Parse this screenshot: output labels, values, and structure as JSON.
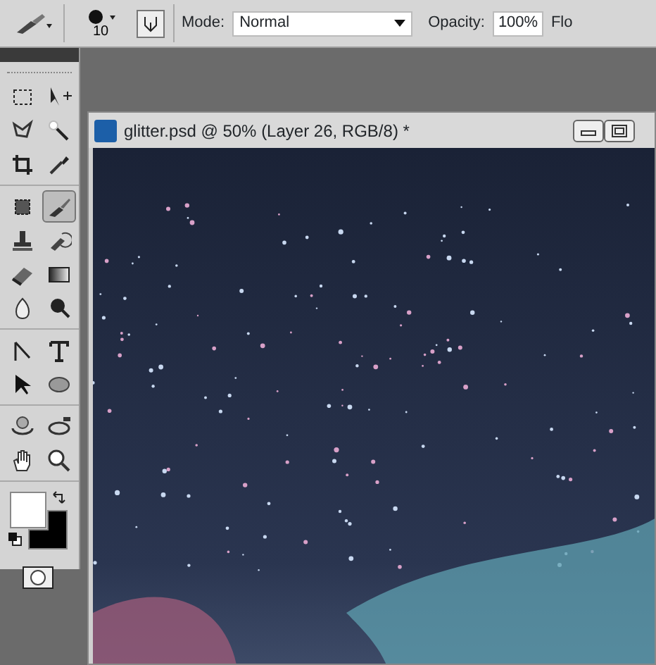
{
  "options_bar": {
    "brush_size": "10",
    "mode_label": "Mode:",
    "mode_value": "Normal",
    "opacity_label": "Opacity:",
    "opacity_value": "100%",
    "flow_label": "Flo"
  },
  "toolbox": {
    "groups": [
      [
        {
          "kind": "marquee",
          "selected": false
        },
        {
          "kind": "move",
          "selected": false
        },
        {
          "kind": "lasso",
          "selected": false
        },
        {
          "kind": "wand",
          "selected": false
        },
        {
          "kind": "crop",
          "selected": false
        },
        {
          "kind": "eyedropper",
          "selected": false
        }
      ],
      [
        {
          "kind": "healing",
          "selected": false
        },
        {
          "kind": "brush",
          "selected": true
        },
        {
          "kind": "stamp",
          "selected": false
        },
        {
          "kind": "history",
          "selected": false
        },
        {
          "kind": "eraser",
          "selected": false
        },
        {
          "kind": "gradient",
          "selected": false
        },
        {
          "kind": "blur",
          "selected": false
        },
        {
          "kind": "burn",
          "selected": false
        }
      ],
      [
        {
          "kind": "pen",
          "selected": false
        },
        {
          "kind": "type",
          "selected": false
        },
        {
          "kind": "pointer",
          "selected": false
        },
        {
          "kind": "ellipse",
          "selected": false
        }
      ],
      [
        {
          "kind": "rotate3d",
          "selected": false
        },
        {
          "kind": "orbit3d",
          "selected": false
        },
        {
          "kind": "hand",
          "selected": false
        },
        {
          "kind": "zoom",
          "selected": false
        }
      ]
    ]
  },
  "document": {
    "title": "glitter.psd @ 50% (Layer 26, RGB/8) *"
  }
}
